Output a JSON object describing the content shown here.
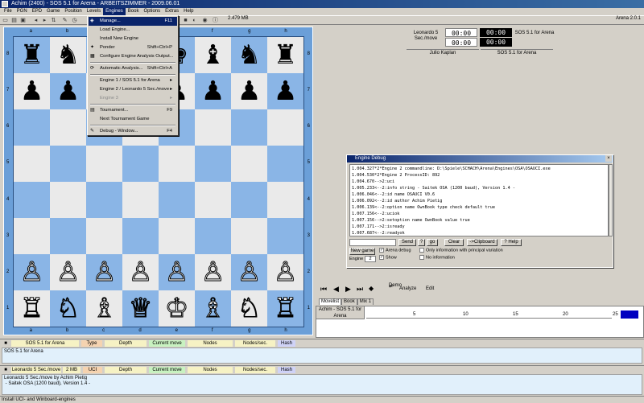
{
  "window": {
    "title": "Achim (2400) - SOS 5.1 for Arena - ARBEITSZIMMER - 2009.06.01"
  },
  "menubar": [
    "File",
    "PGN",
    "EPD",
    "Game",
    "Position",
    "Levels",
    "Engines",
    "Book",
    "Options",
    "Extras",
    "Help"
  ],
  "toolbar": {
    "memory": "2.479 MB",
    "version": "Arena 2.0.1"
  },
  "board": {
    "files": [
      "a",
      "b",
      "c",
      "d",
      "e",
      "f",
      "g",
      "h"
    ],
    "ranks": [
      "8",
      "7",
      "6",
      "5",
      "4",
      "3",
      "2",
      "1"
    ],
    "rows": [
      [
        "♜",
        "♞",
        "♝",
        "♛",
        "♚",
        "♝",
        "♞",
        "♜"
      ],
      [
        "♟",
        "♟",
        "♟",
        "♟",
        "♟",
        "♟",
        "♟",
        "♟"
      ],
      [
        "",
        "",
        "",
        "",
        "",
        "",
        "",
        ""
      ],
      [
        "",
        "",
        "",
        "",
        "",
        "",
        "",
        ""
      ],
      [
        "",
        "",
        "",
        "",
        "",
        "",
        "",
        ""
      ],
      [
        "",
        "",
        "",
        "",
        "",
        "",
        "",
        ""
      ],
      [
        "♙",
        "♙",
        "♙",
        "♙",
        "♙",
        "♙",
        "♙",
        "♙"
      ],
      [
        "♖",
        "♘",
        "♗",
        "♕",
        "♔",
        "♗",
        "♘",
        "♖"
      ]
    ]
  },
  "players": {
    "white_engine": "Leonardo 5 Sec./move",
    "black_engine": "SOS 5.1 for Arena",
    "white_clock_1": "00:00",
    "white_clock_2": "00:00",
    "black_clock_1": "00:00",
    "black_clock_2": "00:00",
    "white_name": "Julio Kaplan",
    "black_name": "SOS 5.1 for Arena"
  },
  "engines_menu": {
    "items": [
      {
        "label": "Manage...",
        "shortcut": "F11"
      },
      {
        "label": "Load Engine...",
        "shortcut": ""
      },
      {
        "label": "Install New Engine",
        "shortcut": ""
      },
      {
        "label": "Ponder",
        "shortcut": "Shift+Ctrl+P"
      },
      {
        "label": "Configure Engine Analysis Output...",
        "shortcut": ""
      },
      {
        "label": "Automatic Analysis...",
        "shortcut": "Shift+Ctrl+A"
      },
      {
        "label": "Engine 1 / SOS 5.1 for Arena",
        "shortcut": "▸"
      },
      {
        "label": "Engine 2 / Leonardo 5 Sec./move",
        "shortcut": "▸"
      },
      {
        "label": "Engine 3",
        "shortcut": "▸"
      },
      {
        "label": "Tournament...",
        "shortcut": "F9"
      },
      {
        "label": "Next Tournament Game",
        "shortcut": ""
      },
      {
        "label": "Debug - Window...",
        "shortcut": "F4"
      }
    ]
  },
  "engine_debug": {
    "title": "Engine Debug",
    "lines": [
      "1.004.327*2*Engine 2 commandline: D:\\Spiele\\SCHACH\\Arena\\Engines\\OSA\\OSAUCI.exe",
      "1.004.530*2*Engine 2 ProcessID: 892",
      "1.004.670-->2:uci",
      "1.005.233<--2:info string - Saitek OSA (1200 baud), Version 1.4 -",
      "1.006.046<--2:id name OSAUCI V0.6",
      "1.006.092<--2:id author Achim Pietig",
      "1.006.139<--2:option name OwnBook type check default true",
      "1.007.156<--2:uciok",
      "1.007.156-->2:setoption name OwnBook value true",
      "1.007.171-->2:isready",
      "1.007.687<--2:readyok",
      "1.008.077-->2:setlevel a3",
      "1.008.874<--2:Setlevel = a3"
    ],
    "btn_send": "Send",
    "btn_q": "?",
    "btn_go": "go",
    "btn_clear": "Clear",
    "btn_clipboard": "->Clipboard",
    "btn_help": "Help",
    "btn_new_game": "New game",
    "chk_arena_debug": "Arena debug",
    "chk_show": "Show",
    "chk_principal": "Only information with principal variation",
    "chk_noinfo": "No information",
    "engine_label": "Engine",
    "engine_value": "2"
  },
  "nav": {
    "demo": "Demo",
    "analyze": "Analyze",
    "edit": "Edit"
  },
  "tabs": [
    "Movelist",
    "Book",
    "Mix 1"
  ],
  "graph": {
    "label": "Achim - SOS 5.1 for Arena",
    "ticks": [
      "5",
      "10",
      "15",
      "20",
      "25"
    ]
  },
  "engine1": {
    "name": "SOS 5.1 for Arena",
    "type_label": "Type",
    "depth_label": "Depth",
    "move_label": "Current move",
    "nodes_label": "Nodes",
    "nps_label": "Nodes/sec.",
    "hash_label": "Hash",
    "output": "SOS 5.1 for Arena"
  },
  "engine2": {
    "name": "Leonardo 5 Sec./move",
    "mem": "2 MB",
    "type_label": "UCI",
    "depth_label": "Depth",
    "move_label": "Current move",
    "nodes_label": "Nodes",
    "nps_label": "Nodes/sec.",
    "hash_label": "Hash",
    "output_1": "Leonardo 5 Sec./move by Achim Pietig",
    "output_2": " - Saitek OSA (1200 baud), Version 1.4 -"
  },
  "status": "Install UCI- and Winboard-engines"
}
